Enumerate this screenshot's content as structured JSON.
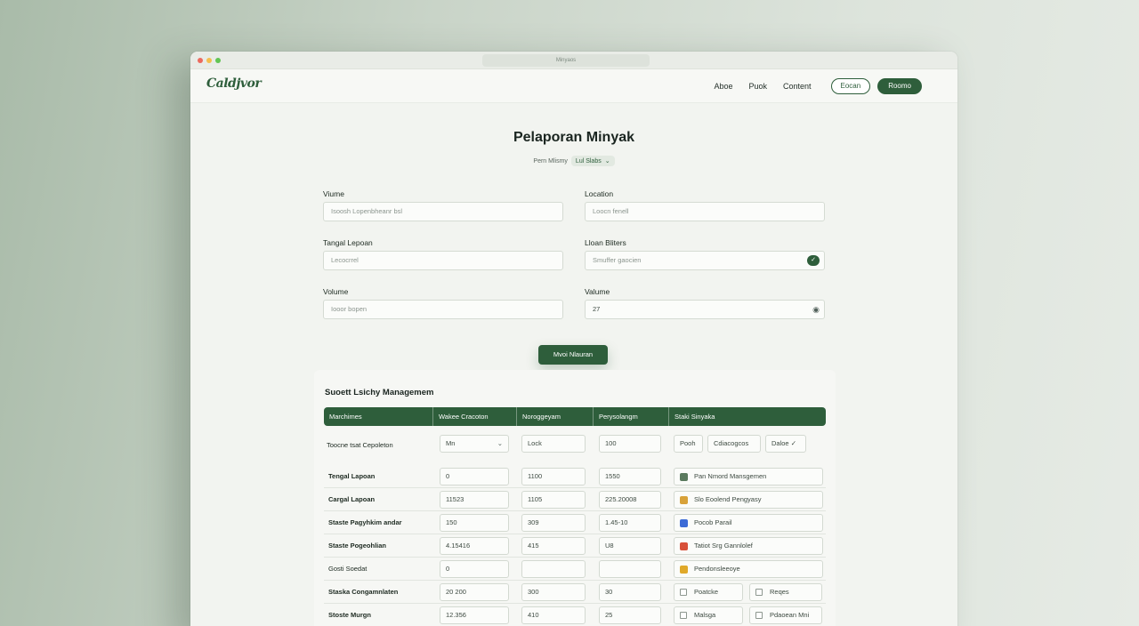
{
  "window": {
    "url": "Minyaos"
  },
  "nav": {
    "logo": "Caldjvor",
    "links": [
      "Aboe",
      "Puok",
      "Content"
    ],
    "outline_button": "Eocan",
    "fill_button": "Roomo"
  },
  "page": {
    "title": "Pelaporan Minyak",
    "sub_label": "Pern Mlismy",
    "sub_select": "Lul Slabs"
  },
  "form": {
    "fields": [
      {
        "label": "Viume",
        "placeholder": "Isoosh Lopenbheanr bsl"
      },
      {
        "label": "Location",
        "placeholder": "Loocn fenell"
      },
      {
        "label": "Tangal Lepoan",
        "placeholder": "Lecocrrel"
      },
      {
        "label": "Lloan Bliters",
        "placeholder": "Smuffer gaocien"
      },
      {
        "label": "Volume",
        "placeholder": "Iooor bopen"
      },
      {
        "label": "Valume",
        "value": "27"
      }
    ],
    "submit": "Mvoi Nlauran"
  },
  "table": {
    "title": "Suoett Lsichy Managemem",
    "headers": [
      "Marchimes",
      "Wakee Cracoton",
      "Noroggeyam",
      "Perysolangm",
      "Staki Sinyaka"
    ],
    "first_row": {
      "label": "Toocne tsat Cepoleton",
      "select": "Mn",
      "c3": "Lock",
      "c4": "100",
      "pills": [
        "Pooh",
        "Cdiacogcos",
        "Daloe"
      ]
    },
    "rows": [
      {
        "label": "Tengal Lapoan",
        "c2": "0",
        "c3": "1100",
        "c4": "1550",
        "status": "Pan Nmord Mansgemen",
        "status_color": "#5a7a5e",
        "bold": true
      },
      {
        "label": "Cargal Lapoan",
        "c2": "11523",
        "c3": "1105",
        "c4": "225.20008",
        "status": "Slo Eoolend Pengyasy",
        "status_color": "#d8a23a",
        "bold": true
      },
      {
        "label": "Staste Pagyhkim andar",
        "c2": "150",
        "c3": "309",
        "c4": "1.45-10",
        "status": "Pocob Parail",
        "status_color": "#3c6bd6",
        "bold": true
      },
      {
        "label": "Staste Pogeohlian",
        "c2": "4.15416",
        "c3": "415",
        "c4": "U8",
        "status": "Tatiot Srg Gannlolef",
        "status_color": "#d8503a",
        "bold": true
      },
      {
        "label": "Gosti Soedat",
        "c2": "0",
        "c3": "",
        "c4": "",
        "status": "Pendonsleeoye",
        "status_color": "#e0a92a",
        "bold": false
      },
      {
        "label": "Staska Congamnlaten",
        "c2": "20 200",
        "c3": "300",
        "c4": "30",
        "checks": [
          "Poatcke",
          "Reqes"
        ],
        "bold": true
      },
      {
        "label": "Stoste Murgn",
        "c2": "12.356",
        "c3": "410",
        "c4": "25",
        "checks": [
          "Malsga",
          "Pdaoean Mni"
        ],
        "bold": true
      }
    ]
  }
}
